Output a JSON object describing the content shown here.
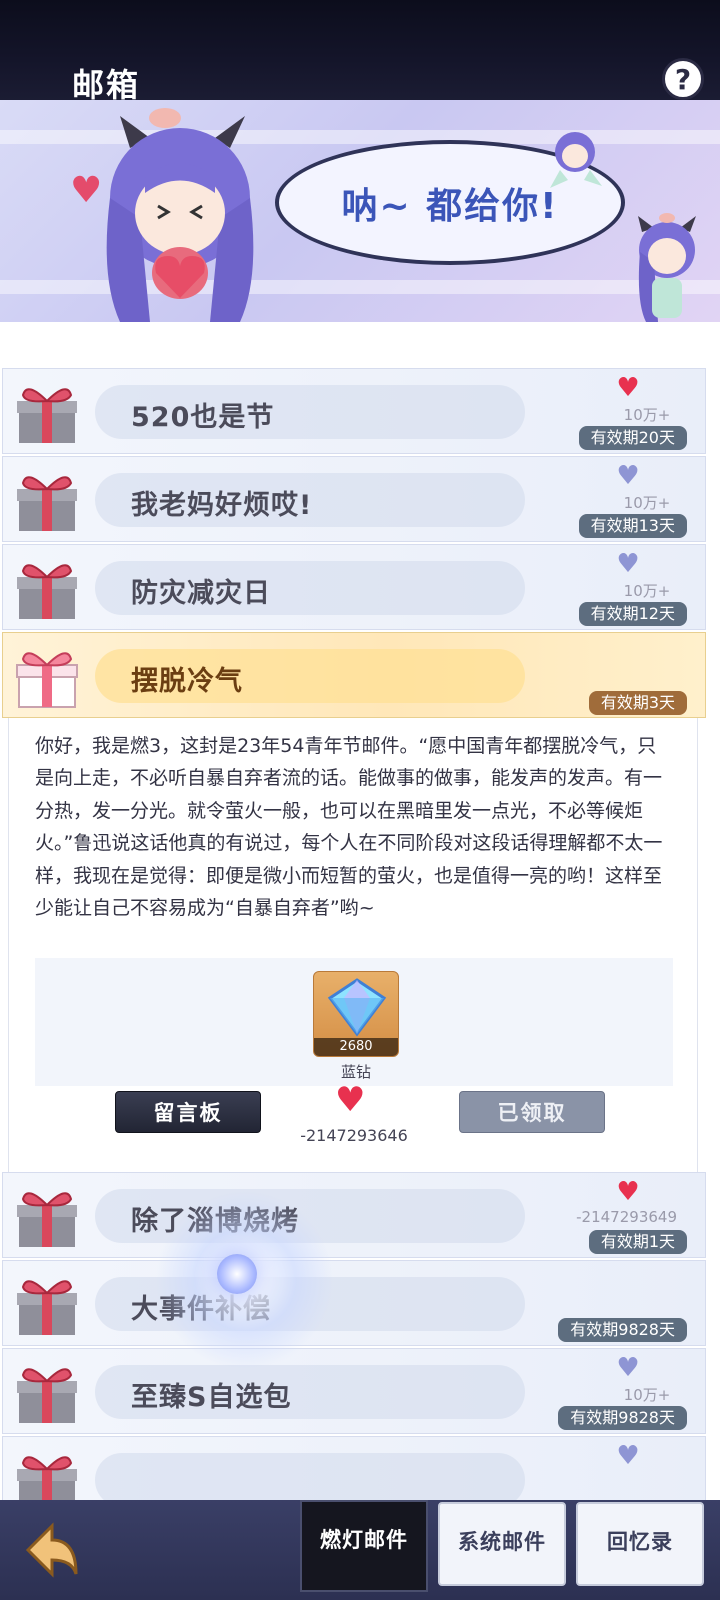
{
  "header": {
    "title": "邮箱",
    "help_label": "?"
  },
  "banner": {
    "speech": "呐~ 都给你!"
  },
  "mails": [
    {
      "title": "520也是节",
      "heart": "red",
      "likes": "10万+",
      "expiry": "有效期20天"
    },
    {
      "title": "我老妈好烦哎!",
      "heart": "blue",
      "likes": "10万+",
      "expiry": "有效期13天"
    },
    {
      "title": "防灾减灾日",
      "heart": "blue",
      "likes": "10万+",
      "expiry": "有效期12天"
    },
    {
      "title": "摆脱冷气",
      "heart": "",
      "likes": "",
      "expiry": "有效期3天",
      "active": true
    },
    {
      "title": "除了淄博烧烤",
      "heart": "red",
      "likes": "-2147293649",
      "expiry": "有效期1天"
    },
    {
      "title": "大事件补偿",
      "heart": "",
      "likes": "",
      "expiry": "有效期9828天"
    },
    {
      "title": "至臻S自选包",
      "heart": "blue",
      "likes": "10万+",
      "expiry": "有效期9828天"
    }
  ],
  "detail": {
    "body": "你好，我是燃3，这封是23年54青年节邮件。“愿中国青年都摆脱冷气，只是向上走，不必听自暴自弃者流的话。能做事的做事，能发声的发声。有一分热，发一分光。就令萤火一般，也可以在黑暗里发一点光，不必等候炬火。”鲁迅说这话他真的有说过，每个人在不同阶段对这段话得理解都不太一样，我现在是觉得：即便是微小而短暂的萤火，也是值得一亮的哟！这样至少能让自己不容易成为“自暴自弃者”哟~",
    "reward": {
      "name": "蓝钻",
      "qty": "2680"
    },
    "message_board_label": "留言板",
    "likes": "-2147293646",
    "claimed_label": "已领取"
  },
  "nav": {
    "tabs": [
      "燃灯邮件",
      "系统邮件",
      "回忆录"
    ],
    "active_tab": 0
  },
  "colors": {
    "accent_red": "#e8314f",
    "heart_blue": "#8e95d4",
    "expiry_bg": "#5d6d7f",
    "active_expiry_bg": "#a06c3a"
  }
}
